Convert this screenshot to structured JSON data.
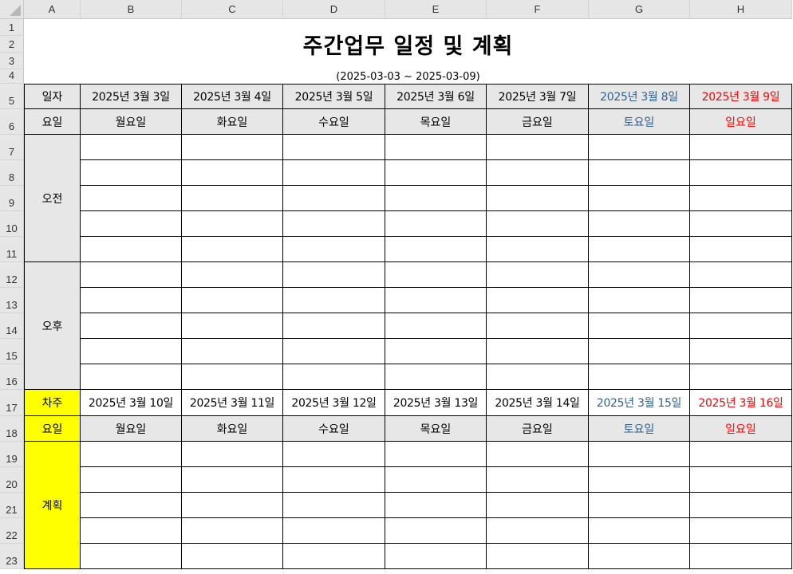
{
  "columns": [
    "A",
    "B",
    "C",
    "D",
    "E",
    "F",
    "G",
    "H"
  ],
  "rows": [
    "1",
    "2",
    "3",
    "4",
    "5",
    "6",
    "7",
    "8",
    "9",
    "10",
    "11",
    "12",
    "13",
    "14",
    "15",
    "16",
    "17",
    "18",
    "19",
    "20",
    "21",
    "22",
    "23"
  ],
  "title": "주간업무 일정 및 계획",
  "date_range": "(2025-03-03 ~ 2025-03-09)",
  "this_week": {
    "label_date": "일자",
    "label_day": "요일",
    "dates": [
      "2025년 3월 3일",
      "2025년 3월 4일",
      "2025년 3월 5일",
      "2025년 3월 6일",
      "2025년 3월 7일",
      "2025년 3월 8일",
      "2025년 3월 9일"
    ],
    "days": [
      "월요일",
      "화요일",
      "수요일",
      "목요일",
      "금요일",
      "토요일",
      "일요일"
    ],
    "am": "오전",
    "pm": "오후"
  },
  "next_week": {
    "label_week": "차주",
    "label_day": "요일",
    "dates": [
      "2025년 3월 10일",
      "2025년 3월 11일",
      "2025년 3월 12일",
      "2025년 3월 13일",
      "2025년 3월 14일",
      "2025년 3월 15일",
      "2025년 3월 16일"
    ],
    "days": [
      "월요일",
      "화요일",
      "수요일",
      "목요일",
      "금요일",
      "토요일",
      "일요일"
    ],
    "plan": "계획"
  },
  "colors": {
    "saturday": "#2f5f8f",
    "sunday": "#ff0000",
    "highlight": "#ffff00",
    "label_fill": "#e7e7e7"
  }
}
